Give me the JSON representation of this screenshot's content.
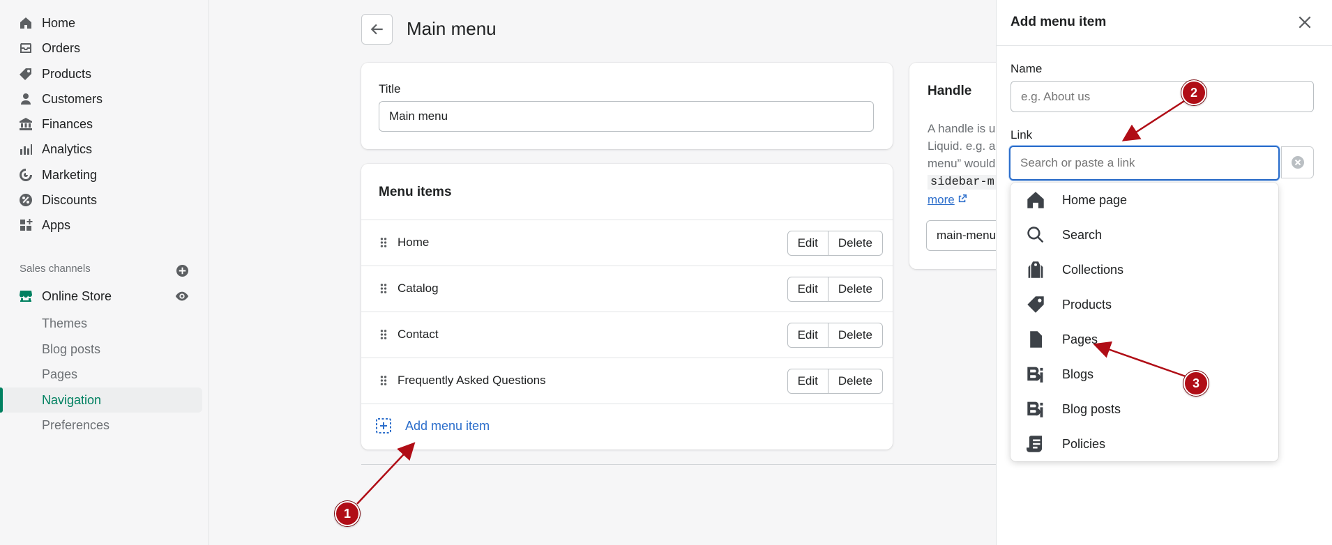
{
  "sidebar": {
    "items": [
      {
        "label": "Home",
        "icon": "home-icon"
      },
      {
        "label": "Orders",
        "icon": "inbox-icon"
      },
      {
        "label": "Products",
        "icon": "tag-icon"
      },
      {
        "label": "Customers",
        "icon": "person-icon"
      },
      {
        "label": "Finances",
        "icon": "bank-icon"
      },
      {
        "label": "Analytics",
        "icon": "bar-chart-icon"
      },
      {
        "label": "Marketing",
        "icon": "target-icon"
      },
      {
        "label": "Discounts",
        "icon": "discount-icon"
      },
      {
        "label": "Apps",
        "icon": "apps-icon"
      }
    ],
    "sales_channels_label": "Sales channels",
    "online_store_label": "Online Store",
    "sub_items": [
      {
        "label": "Themes"
      },
      {
        "label": "Blog posts"
      },
      {
        "label": "Pages"
      },
      {
        "label": "Navigation",
        "active": true
      },
      {
        "label": "Preferences"
      }
    ],
    "accent_color": "#008060"
  },
  "header": {
    "title": "Main menu"
  },
  "title_card": {
    "label": "Title",
    "value": "Main menu"
  },
  "menu_items_card": {
    "heading": "Menu items",
    "items": [
      {
        "label": "Home"
      },
      {
        "label": "Catalog"
      },
      {
        "label": "Contact"
      },
      {
        "label": "Frequently Asked Questions"
      }
    ],
    "edit_label": "Edit",
    "delete_label": "Delete",
    "add_label": "Add menu item"
  },
  "handle_card": {
    "heading": "Handle",
    "lines": [
      "A handle is u",
      "Liquid. e.g. a",
      "menu” would"
    ],
    "code": "sidebar-m",
    "more_link": "more",
    "value": "main-menu"
  },
  "drawer": {
    "title": "Add menu item",
    "name_label": "Name",
    "name_placeholder": "e.g. About us",
    "link_label": "Link",
    "link_placeholder": "Search or paste a link",
    "options": [
      {
        "label": "Home page",
        "icon": "home-icon"
      },
      {
        "label": "Search",
        "icon": "search-icon"
      },
      {
        "label": "Collections",
        "icon": "collections-icon"
      },
      {
        "label": "Products",
        "icon": "tag-icon"
      },
      {
        "label": "Pages",
        "icon": "page-icon"
      },
      {
        "label": "Blogs",
        "icon": "blog-icon"
      },
      {
        "label": "Blog posts",
        "icon": "blog-icon"
      },
      {
        "label": "Policies",
        "icon": "policy-icon"
      }
    ]
  },
  "annotations": [
    {
      "number": "1"
    },
    {
      "number": "2"
    },
    {
      "number": "3"
    }
  ],
  "annotation_color": "#b00d16",
  "link_color": "#2c6ecb"
}
